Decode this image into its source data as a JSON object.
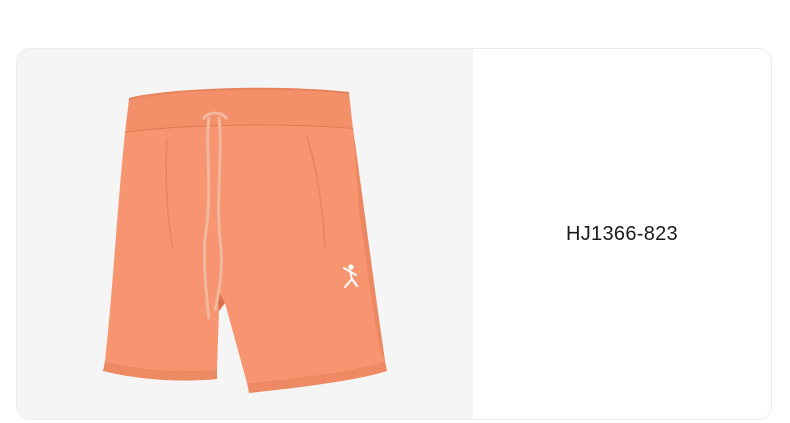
{
  "product": {
    "sku": "HJ1366-823",
    "image_subject": "shorts",
    "image_icon": "jumpman-logo-icon",
    "colors": {
      "garment": "#f6956f",
      "garment_shadow": "#e9825c",
      "image_background": "#f5f5f5"
    }
  }
}
